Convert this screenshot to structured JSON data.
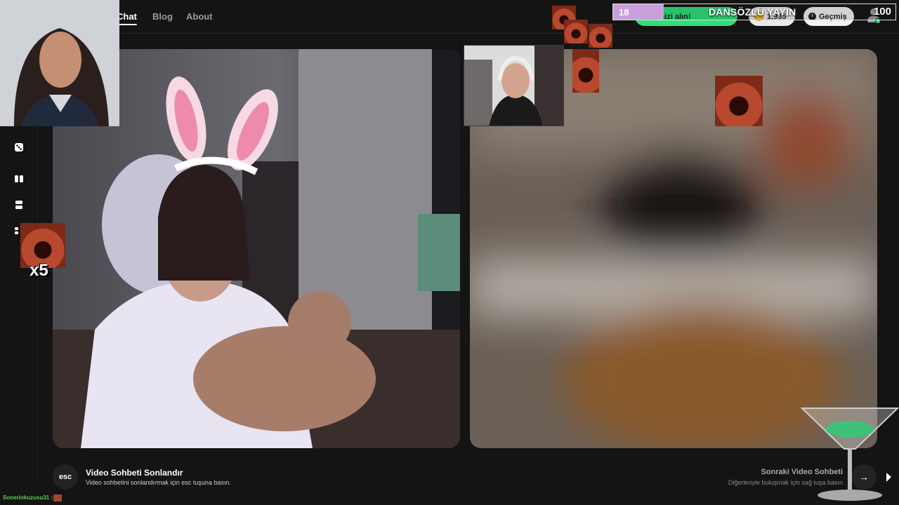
{
  "nav": {
    "items": [
      {
        "label": "Chat",
        "active": true
      },
      {
        "label": "Blog",
        "active": false
      },
      {
        "label": "About",
        "active": false
      }
    ]
  },
  "header": {
    "promo_label": "llerinizi alın!",
    "coins": "1,935",
    "history_label": "Geçmiş"
  },
  "stream_overlay": {
    "counter": "18",
    "title": "DANSÖZLÜ YAYIN",
    "goal": "100",
    "progress_fraction": 0.18,
    "combo_label": "x5"
  },
  "sidebar": {
    "icons": [
      "dice-icon",
      "layout-columns-icon",
      "layout-rows-icon",
      "layout-grid-icon"
    ]
  },
  "footer": {
    "esc_key": "esc",
    "end_title": "Video Sohbeti Sonlandır",
    "end_desc": "Video sohbetini sonlandırmak için esc tuşuna basın.",
    "next_title": "Sonraki Video Sohbeti",
    "next_desc": "Diğerleriyle buluşmak için sağ tuşa basın",
    "next_arrow": "→"
  },
  "chat": {
    "username": "Sonerinkuzusu31 :"
  },
  "colors": {
    "accent_green": "#2ee07a",
    "overlay_purple": "#c9a0dc",
    "background": "#141414"
  }
}
